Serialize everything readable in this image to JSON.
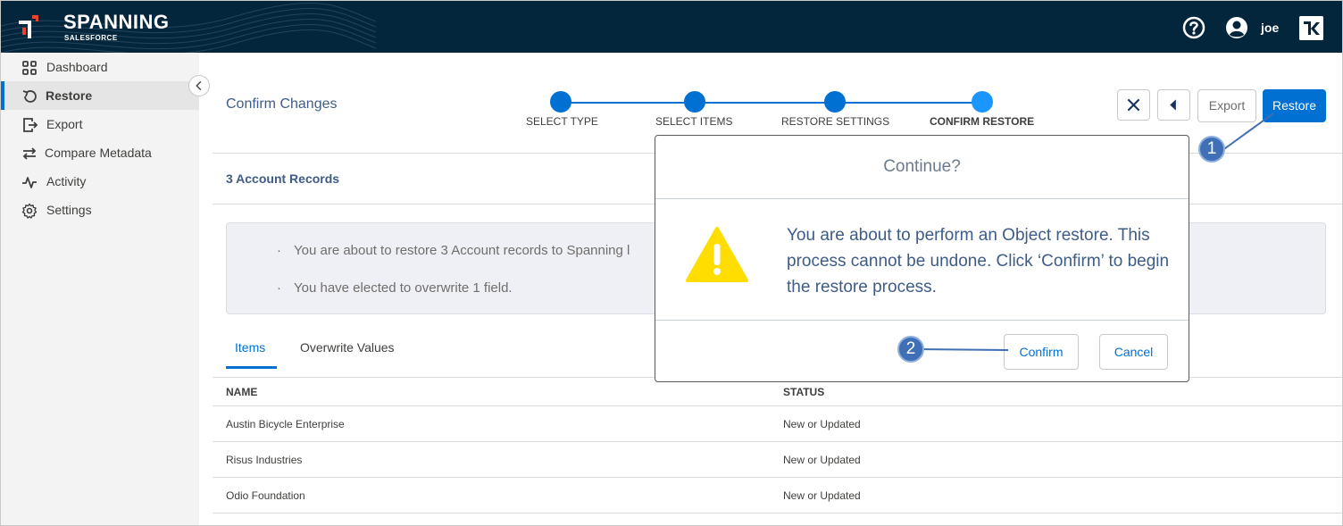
{
  "header": {
    "brand": "SPANNING",
    "brand_sub": "SALESFORCE",
    "username": "joe",
    "icons": [
      "help-icon",
      "user-icon",
      "kaseya-logo"
    ]
  },
  "sidebar": {
    "items": [
      {
        "label": "Dashboard",
        "icon": "grid-icon"
      },
      {
        "label": "Restore",
        "icon": "restore-icon",
        "active": true
      },
      {
        "label": "Export",
        "icon": "export-icon"
      },
      {
        "label": "Compare Metadata",
        "icon": "compare-icon"
      },
      {
        "label": "Activity",
        "icon": "activity-icon"
      },
      {
        "label": "Settings",
        "icon": "gear-icon"
      }
    ]
  },
  "main": {
    "title": "Confirm Changes",
    "steps": [
      {
        "label": "SELECT TYPE"
      },
      {
        "label": "SELECT ITEMS"
      },
      {
        "label": "RESTORE SETTINGS"
      },
      {
        "label": "CONFIRM RESTORE",
        "current": true
      }
    ],
    "buttons": {
      "export": "Export",
      "restore": "Restore"
    },
    "records_title": "3 Account Records",
    "info": [
      "You are about to restore 3 Account records to Spanning l",
      "You have elected to overwrite 1 field."
    ],
    "tabs": [
      {
        "label": "Items",
        "active": true
      },
      {
        "label": "Overwrite Values"
      }
    ],
    "table": {
      "columns": [
        "NAME",
        "STATUS"
      ],
      "rows": [
        [
          "Austin Bicycle Enterprise",
          "New or Updated"
        ],
        [
          "Risus Industries",
          "New or Updated"
        ],
        [
          "Odio Foundation",
          "New or Updated"
        ]
      ]
    }
  },
  "modal": {
    "title": "Continue?",
    "message": "You are about to perform an Object restore. This process cannot be undone. Click ‘Confirm’ to begin the restore process.",
    "confirm": "Confirm",
    "cancel": "Cancel"
  },
  "callouts": [
    "1",
    "2"
  ],
  "colors": {
    "header_bg": "#04263c",
    "accent": "#0070d2",
    "warning": "#ffdd00",
    "callout": "#3f6fb5"
  }
}
